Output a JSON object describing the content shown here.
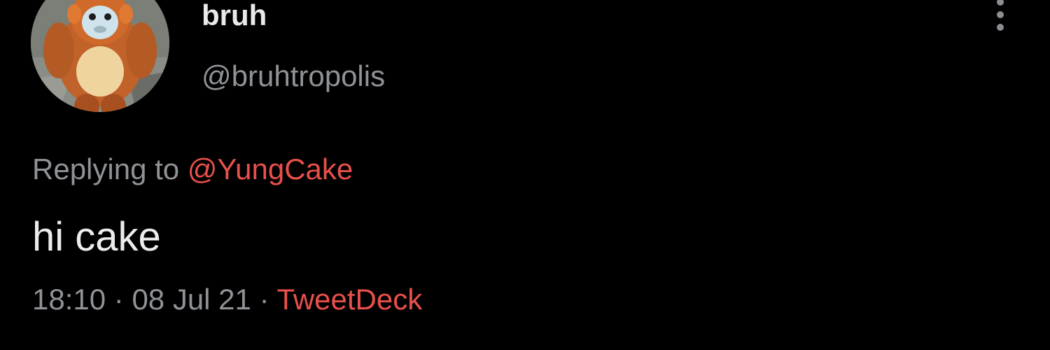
{
  "user": {
    "display_name": "bruh",
    "handle": "@bruhtropolis",
    "avatar_icon": "monkey-avatar-icon"
  },
  "reply": {
    "prefix": "Replying to ",
    "mention": "@YungCake"
  },
  "tweet": {
    "text": "hi cake"
  },
  "meta": {
    "time": "18:10",
    "sep1": " · ",
    "date": "08 Jul 21",
    "sep2": " · ",
    "source": "TweetDeck"
  },
  "menu": {
    "icon": "more-vertical-icon"
  },
  "colors": {
    "background": "#000000",
    "accent": "#e8504b",
    "muted": "#8f9296",
    "text": "#ececec"
  }
}
